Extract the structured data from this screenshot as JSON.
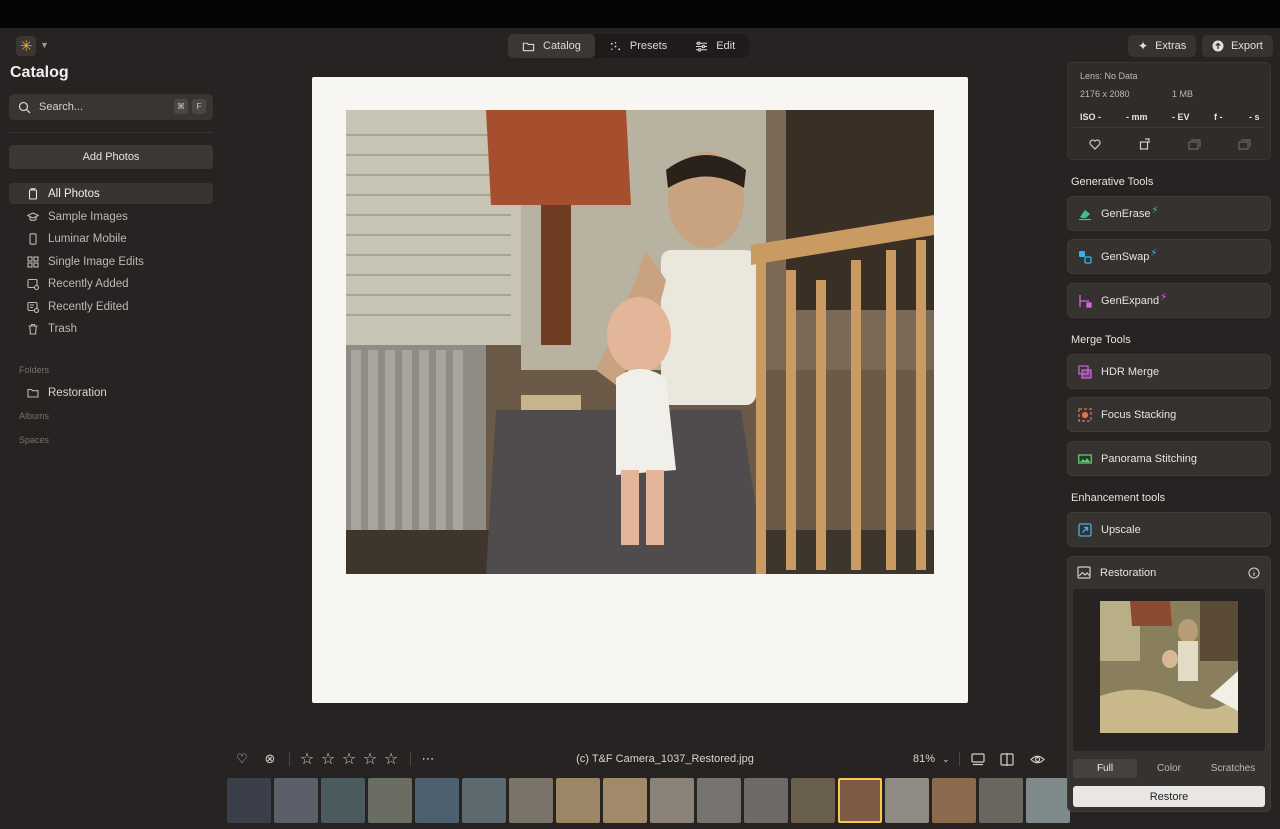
{
  "header": {
    "tabs": [
      {
        "label": "Catalog",
        "icon": "folder-icon",
        "active": true
      },
      {
        "label": "Presets",
        "icon": "sparkle-grid-icon",
        "active": false
      },
      {
        "label": "Edit",
        "icon": "sliders-icon",
        "active": false
      }
    ],
    "extras_label": "Extras",
    "export_label": "Export"
  },
  "sidebar": {
    "title": "Catalog",
    "search_placeholder": "Search...",
    "shortcut_cmd": "⌘",
    "shortcut_key": "F",
    "add_photos_label": "Add Photos",
    "items": [
      {
        "label": "All Photos",
        "icon": "photos-icon",
        "active": true
      },
      {
        "label": "Sample Images",
        "icon": "graduation-cap-icon",
        "active": false
      },
      {
        "label": "Luminar Mobile",
        "icon": "phone-icon",
        "active": false
      },
      {
        "label": "Single Image Edits",
        "icon": "grid-icon",
        "active": false
      },
      {
        "label": "Recently Added",
        "icon": "image-plus-icon",
        "active": false
      },
      {
        "label": "Recently Edited",
        "icon": "image-edit-icon",
        "active": false
      },
      {
        "label": "Trash",
        "icon": "trash-icon",
        "active": false
      }
    ],
    "folders_label": "Folders",
    "folders": [
      {
        "label": "Restoration",
        "icon": "folder-icon"
      }
    ],
    "albums_label": "Albums",
    "spaces_label": "Spaces"
  },
  "canvas": {
    "filename": "(c) T&F Camera_1037_Restored.jpg",
    "zoom": "81%",
    "zoom_chevron": "⌄",
    "rating_stars": 5,
    "star_char": "☆",
    "heart_char": "♡",
    "reject_char": "⊗",
    "more_char": "⋯",
    "thumbnail_count": 18,
    "selected_thumbnail": 13
  },
  "info": {
    "lens": "Lens: No Data",
    "dimensions": "2176 x 2080",
    "size": "1 MB",
    "iso": "ISO -",
    "focal": "- mm",
    "ev": "- EV",
    "aperture": "f -",
    "shutter": "- s"
  },
  "tools": {
    "generative_heading": "Generative Tools",
    "generative": [
      {
        "label": "GenErase",
        "icon": "eraser-icon",
        "color": "#3ec28f",
        "bolt": "#3ec28f"
      },
      {
        "label": "GenSwap",
        "icon": "swap-icon",
        "color": "#2fb5e8",
        "bolt": "#2fb5e8"
      },
      {
        "label": "GenExpand",
        "icon": "expand-icon",
        "color": "#d068d8",
        "bolt": "#d068d8"
      }
    ],
    "merge_heading": "Merge Tools",
    "merge": [
      {
        "label": "HDR Merge",
        "icon": "hdr-icon",
        "color": "#c462d6"
      },
      {
        "label": "Focus Stacking",
        "icon": "focus-icon",
        "color": "#e0714f"
      },
      {
        "label": "Panorama Stitching",
        "icon": "panorama-icon",
        "color": "#4fd26b"
      }
    ],
    "enhancement_heading": "Enhancement tools",
    "enhancement": [
      {
        "label": "Upscale",
        "icon": "upscale-icon",
        "color": "#38b6e6"
      }
    ]
  },
  "restoration": {
    "title": "Restoration",
    "modes": [
      "Full",
      "Color",
      "Scratches"
    ],
    "active_mode": "Full",
    "restore_label": "Restore",
    "bolt_char": "⚡"
  },
  "colors": {
    "accent": "#f2c94c",
    "app_background": "#262322",
    "panel": "#2f2c2a"
  }
}
